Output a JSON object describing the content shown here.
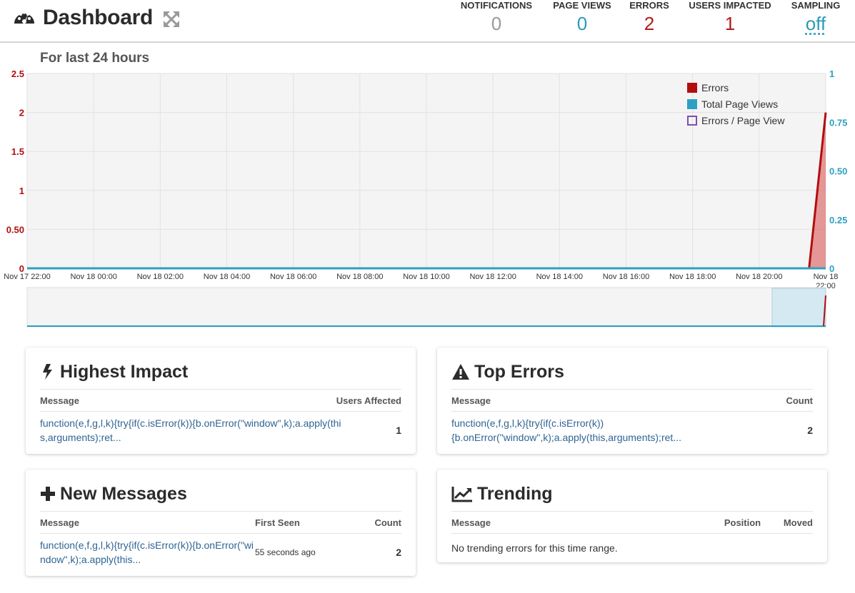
{
  "header": {
    "title": "Dashboard",
    "stats": [
      {
        "label": "NOTIFICATIONS",
        "value": "0",
        "color": "#9a9a9a"
      },
      {
        "label": "PAGE VIEWS",
        "value": "0",
        "color": "#2c9ab7"
      },
      {
        "label": "ERRORS",
        "value": "2",
        "color": "#b31b1b"
      },
      {
        "label": "USERS IMPACTED",
        "value": "1",
        "color": "#b31b1b"
      },
      {
        "label": "SAMPLING",
        "value": "off",
        "color": "#2c9ab7"
      }
    ]
  },
  "subtitle": "For last 24 hours",
  "colors": {
    "errors": "#b30e0e",
    "page_views": "#2e9fc2",
    "ratio": "#7b4fae"
  },
  "chart_data": {
    "type": "area",
    "x": [
      "Nov 17 22:00",
      "Nov 18 00:00",
      "Nov 18 02:00",
      "Nov 18 04:00",
      "Nov 18 06:00",
      "Nov 18 08:00",
      "Nov 18 10:00",
      "Nov 18 12:00",
      "Nov 18 14:00",
      "Nov 18 16:00",
      "Nov 18 18:00",
      "Nov 18 20:00",
      "Nov 18 22:00"
    ],
    "left_axis": {
      "ticks": [
        "0",
        "0.50",
        "1",
        "1.5",
        "2",
        "2.5"
      ],
      "ylim": [
        0,
        2.5
      ],
      "color": "#b30e0e"
    },
    "right_axis": {
      "ticks": [
        "0",
        "0.25",
        "0.50",
        "0.75",
        "1"
      ],
      "ylim": [
        0,
        1
      ],
      "color": "#2e9fc2"
    },
    "series": [
      {
        "name": "Errors",
        "points": [
          [
            "Nov 17 22:00",
            0
          ],
          [
            "Nov 18 21:30",
            0
          ],
          [
            "Nov 18 22:00",
            2
          ]
        ]
      },
      {
        "name": "Total Page Views",
        "points": [
          [
            "Nov 17 22:00",
            0
          ],
          [
            "Nov 18 22:00",
            0
          ]
        ]
      },
      {
        "name": "Errors / Page View",
        "points": []
      }
    ],
    "legend": "top-right",
    "grid": true
  },
  "cards": {
    "highest_impact": {
      "title": "Highest Impact",
      "cols": [
        "Message",
        "Users Affected"
      ],
      "rows": [
        {
          "message": "function(e,f,g,l,k){try{if(c.isError(k)){b.onError(\"window\",k);a.apply(this,arguments);ret...",
          "value": "1"
        }
      ]
    },
    "top_errors": {
      "title": "Top Errors",
      "cols": [
        "Message",
        "Count"
      ],
      "rows": [
        {
          "message": "function(e,f,g,l,k){try{if(c.isError(k)){b.onError(\"window\",k);a.apply(this,arguments);ret...",
          "value": "2"
        }
      ]
    },
    "new_messages": {
      "title": "New Messages",
      "cols": [
        "Message",
        "First Seen",
        "Count"
      ],
      "rows": [
        {
          "message": "function(e,f,g,l,k){try{if(c.isError(k)){b.onError(\"window\",k);a.apply(this...",
          "first_seen": "55 seconds ago",
          "value": "2"
        }
      ]
    },
    "trending": {
      "title": "Trending",
      "cols": [
        "Message",
        "Position",
        "Moved"
      ],
      "empty": "No trending errors for this time range."
    }
  }
}
